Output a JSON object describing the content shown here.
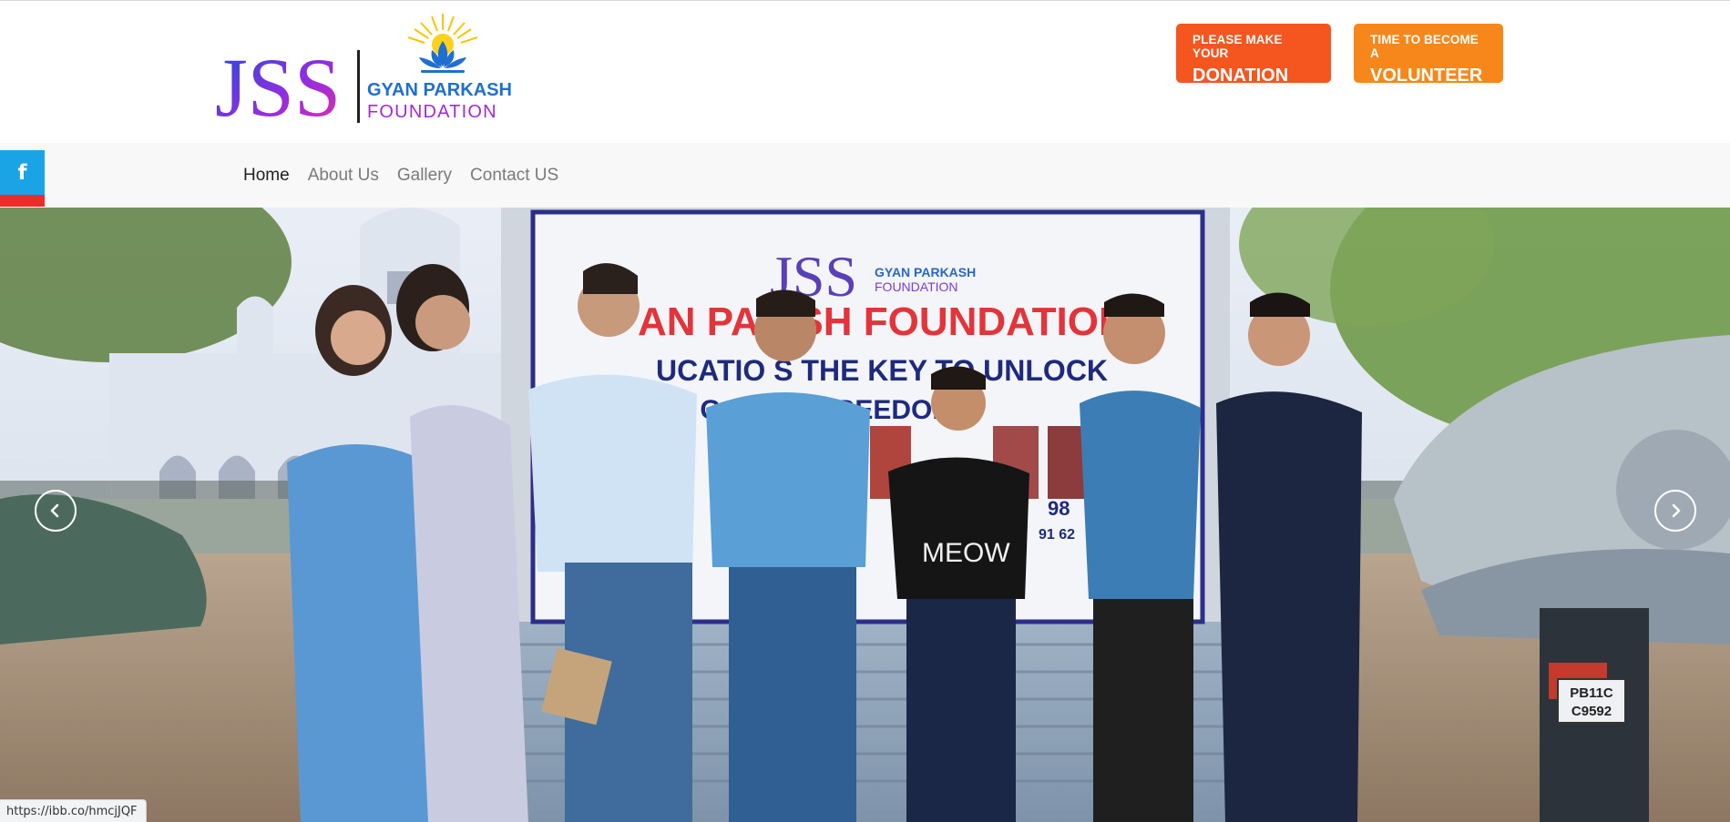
{
  "header": {
    "logo": {
      "jss": "JSS",
      "line1": "GYAN PARKASH",
      "line2": "FOUNDATION"
    },
    "donate": {
      "small": "PLEASE MAKE YOUR",
      "big": "DONATION"
    },
    "volunteer": {
      "small": "TIME TO BECOME A",
      "big": "VOLUNTEER"
    }
  },
  "nav": {
    "items": [
      {
        "label": "Home"
      },
      {
        "label": "About Us"
      },
      {
        "label": "Gallery"
      },
      {
        "label": "Contact US"
      }
    ],
    "active": "Home"
  },
  "social": {
    "facebook_glyph": "f"
  },
  "hero": {
    "banner": {
      "logo_jss": "JSS",
      "logo_line1": "GYAN PARKASH",
      "logo_line2": "FOUNDATION",
      "title": "AN PA  ASH FOUNDATION",
      "line1": "UCATIO  S THE KEY TO UNLOCK",
      "line2": "E G    DOOR   FREEDOM",
      "phone1": "98",
      "phone2": "91 62"
    },
    "tshirt_text": "MEOW",
    "plate_line1": "PB11C",
    "plate_line2": "C9592"
  },
  "status_bar": {
    "url": "https://ibb.co/hmcjJQF"
  },
  "colors": {
    "donate": "#f5551f",
    "volunteer": "#f7871a",
    "facebook": "#1aa4e6",
    "accent_red": "#ed2b2b",
    "logo_purple": "#9b2fd8"
  }
}
